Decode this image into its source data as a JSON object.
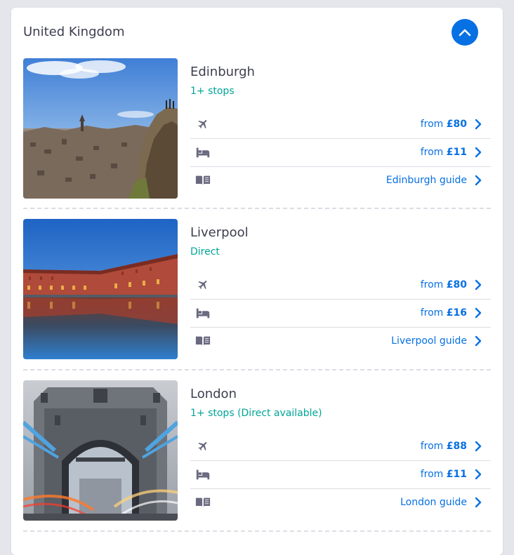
{
  "country": {
    "title": "United Kingdom",
    "collapse_icon": "chevron-up-icon"
  },
  "cities": [
    {
      "name": "Edinburgh",
      "stops": "1+ stops",
      "flight_prefix": "from ",
      "flight_price": "£80",
      "hotel_prefix": "from ",
      "hotel_price": "£11",
      "guide_label": "Edinburgh guide"
    },
    {
      "name": "Liverpool",
      "stops": "Direct",
      "flight_prefix": "from ",
      "flight_price": "£80",
      "hotel_prefix": "from ",
      "hotel_price": "£16",
      "guide_label": "Liverpool guide"
    },
    {
      "name": "London",
      "stops": "1+ stops (Direct available)",
      "flight_prefix": "from ",
      "flight_price": "£88",
      "hotel_prefix": "from ",
      "hotel_price": "£11",
      "guide_label": "London guide"
    }
  ],
  "icons": {
    "flight": "plane-icon",
    "hotel": "bed-icon",
    "guide": "book-icon",
    "link": "chevron-right-icon"
  },
  "colors": {
    "accent": "#0770e3",
    "direct_green": "#00a698",
    "text": "#3d3f4f",
    "icon_grey": "#68697f"
  }
}
